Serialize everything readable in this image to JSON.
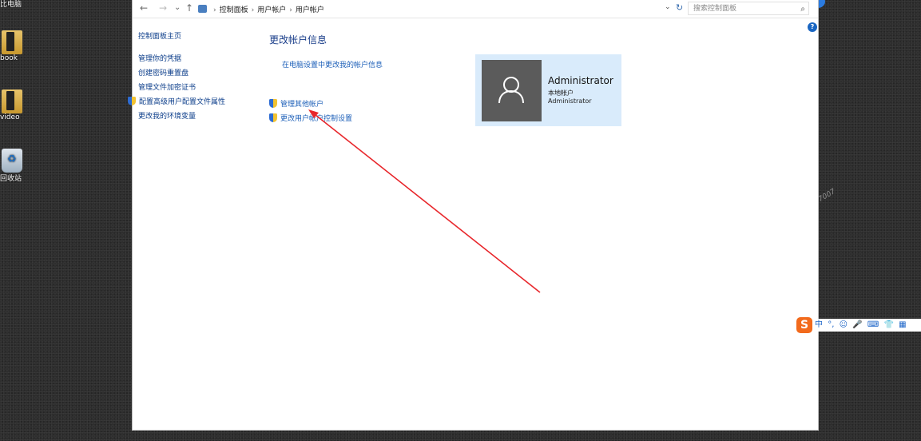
{
  "desktop": {
    "icons": [
      {
        "label": "比电脑"
      },
      {
        "label": "book"
      },
      {
        "label": "video"
      },
      {
        "label": "回收站"
      }
    ]
  },
  "addressbar": {
    "back": "←",
    "forward": "→",
    "history": "⌄",
    "up": "↑",
    "crumbs": [
      "控制面板",
      "用户帐户",
      "用户帐户"
    ],
    "search_placeholder": "搜索控制面板"
  },
  "leftnav": {
    "home": "控制面板主页",
    "links": [
      {
        "label": "管理你的凭据",
        "shield": false
      },
      {
        "label": "创建密码重置盘",
        "shield": false
      },
      {
        "label": "管理文件加密证书",
        "shield": false
      },
      {
        "label": "配置高级用户配置文件属性",
        "shield": true
      },
      {
        "label": "更改我的环境变量",
        "shield": false
      }
    ]
  },
  "main": {
    "title": "更改帐户信息",
    "pc_settings_link": "在电脑设置中更改我的帐户信息",
    "manage_other": "管理其他帐户",
    "uac_settings": "更改用户帐户控制设置"
  },
  "account": {
    "name": "Administrator",
    "type": "本地帐户",
    "group": "Administrator"
  },
  "help": "?",
  "watermark": "7007",
  "ime": {
    "logo": "S",
    "items": [
      "中",
      "°,",
      "☺",
      "🎤",
      "⌨",
      "👕",
      "▦"
    ]
  },
  "colors": {
    "link": "#1c5fb8",
    "card_bg": "#d9ebfb",
    "arrow": "#e8262b"
  }
}
